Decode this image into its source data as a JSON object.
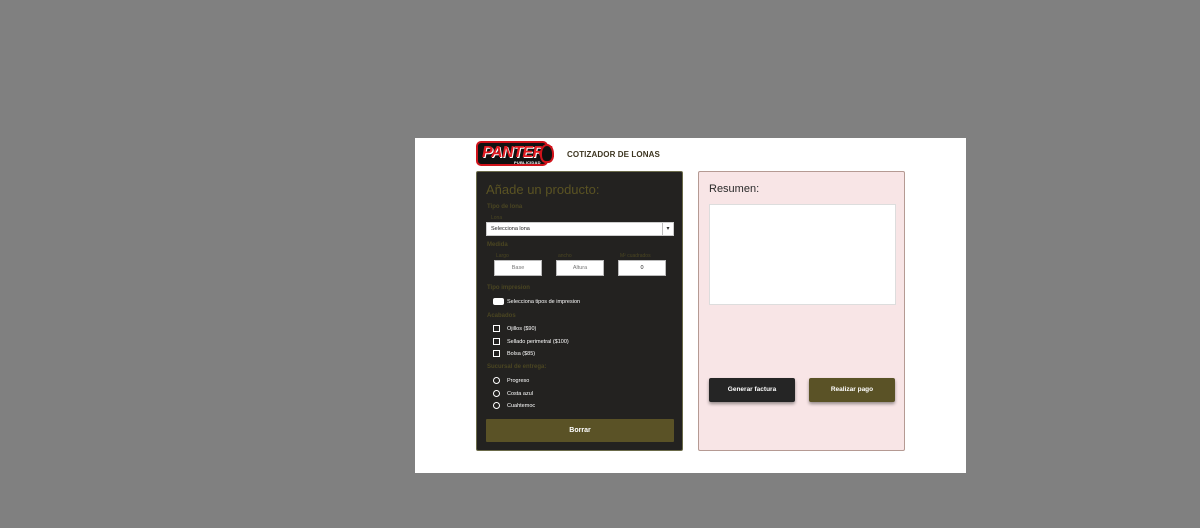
{
  "header": {
    "logo_text": "PANTERA",
    "logo_sub": "PUBLICIDAD",
    "title": "COTIZADOR DE LONAS"
  },
  "form": {
    "title": "Añade un producto:",
    "lona_section": "Tipo de lona",
    "lona_sub": "Lona",
    "lona_select_value": "Selecciona lona",
    "medida_section": "Medida",
    "largo_label": "Largo",
    "ancho_label": "ancho",
    "m2_label": "M² cuadrados",
    "base_placeholder": "Base",
    "altura_placeholder": "Altura",
    "m2_value": "0",
    "impresion_section": "Tipo impresion",
    "impresion_toggle_label": "Selecciona tipos de impresion",
    "acabados_section": "Acabados",
    "acabados": [
      {
        "label": "Ojillos ($90)",
        "checked": false
      },
      {
        "label": "Sellado perimetral ($100)",
        "checked": false
      },
      {
        "label": "Bolsa ($85)",
        "checked": false
      }
    ],
    "sucursal_section": "Sucursal de entrega:",
    "sucursales": [
      {
        "label": "Progreso",
        "selected": false
      },
      {
        "label": "Costa azul",
        "selected": false
      },
      {
        "label": "Cuahtemoc",
        "selected": false
      }
    ],
    "clear_button": "Borrar"
  },
  "summary": {
    "title": "Resumen:",
    "invoice_button": "Generar factura",
    "pay_button": "Realizar pago"
  },
  "colors": {
    "page_bg": "#808080",
    "panel_dark": "#232220",
    "accent_olive": "#5a5226",
    "summary_bg": "#f8e5e6",
    "logo_red": "#e11b22"
  }
}
